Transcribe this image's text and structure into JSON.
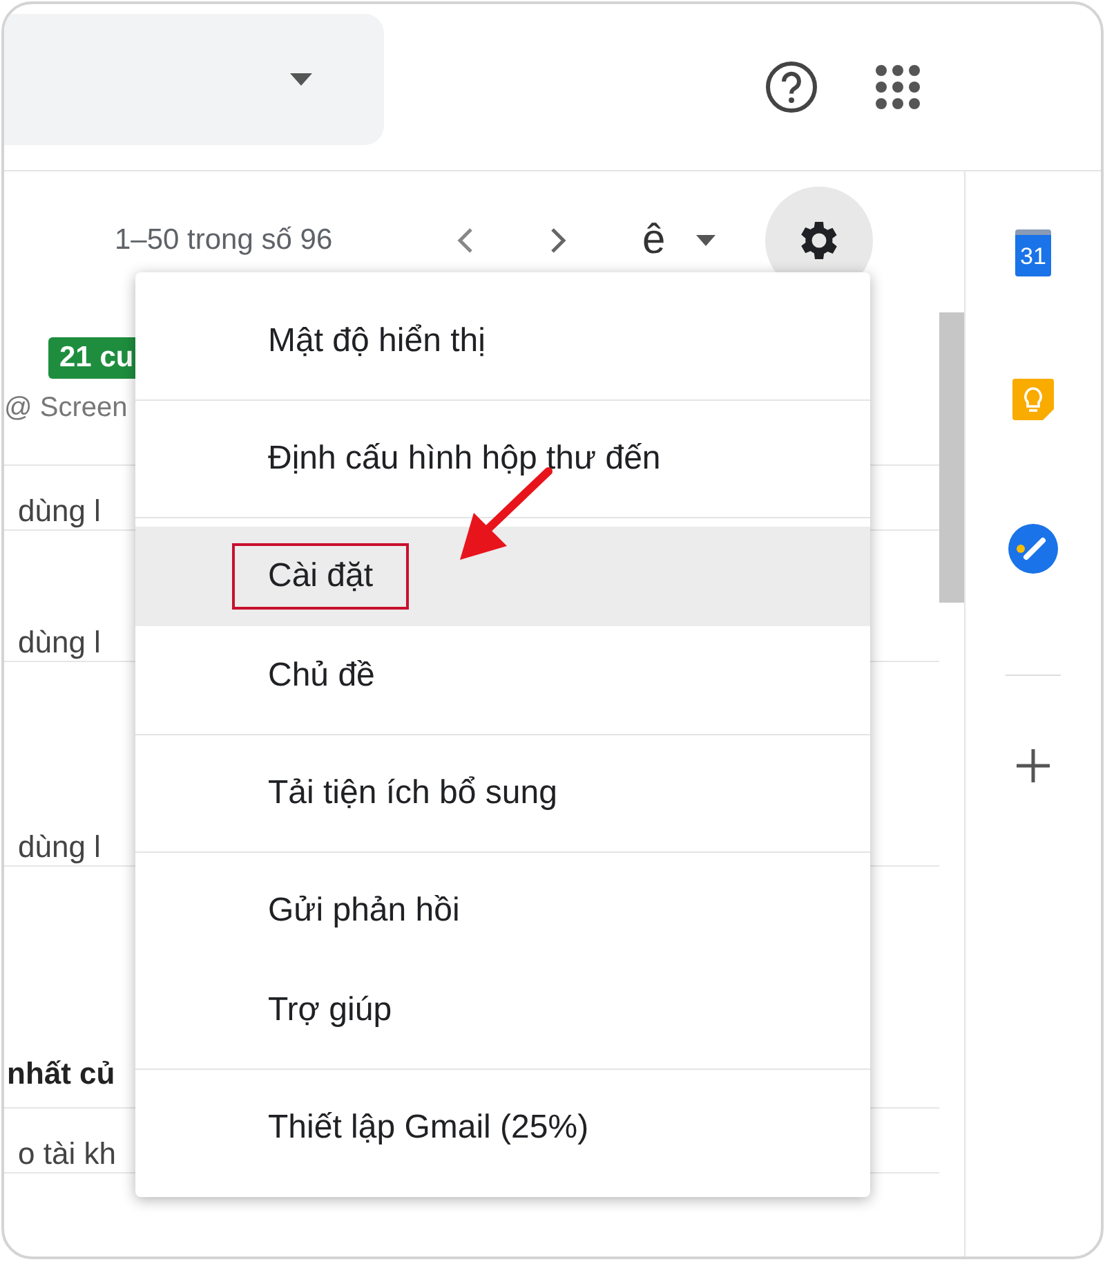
{
  "toolbar": {
    "pagination": "1–50 trong số 96",
    "input_tool": "ê"
  },
  "mail_rows": [
    {
      "kind": "badge",
      "badge": "21 cu",
      "text": "@ Screen"
    },
    {
      "kind": "plain",
      "text": "dùng l"
    },
    {
      "kind": "plain",
      "text": "dùng l"
    },
    {
      "kind": "plain",
      "text": "dùng l"
    },
    {
      "kind": "bold",
      "text": "nhất củ"
    },
    {
      "kind": "plain",
      "text": "o tài kh"
    }
  ],
  "side_panel": [
    {
      "kind": "calendar",
      "label": "31"
    },
    {
      "kind": "keep"
    },
    {
      "kind": "tasks"
    }
  ],
  "menu": {
    "groups": [
      [
        {
          "label": "Mật độ hiển thị",
          "selected": false,
          "annotated": false
        }
      ],
      [
        {
          "label": "Định cấu hình hộp thư đến",
          "selected": false,
          "annotated": false
        }
      ],
      [
        {
          "label": "Cài đặt",
          "selected": true,
          "annotated": true
        },
        {
          "label": "Chủ đề",
          "selected": false,
          "annotated": false
        }
      ],
      [
        {
          "label": "Tải tiện ích bổ sung",
          "selected": false,
          "annotated": false
        }
      ],
      [
        {
          "label": "Gửi phản hồi",
          "selected": false,
          "annotated": false
        },
        {
          "label": "Trợ giúp",
          "selected": false,
          "annotated": false
        }
      ],
      [
        {
          "label": "Thiết lập Gmail (25%)",
          "selected": false,
          "annotated": false
        }
      ]
    ]
  }
}
